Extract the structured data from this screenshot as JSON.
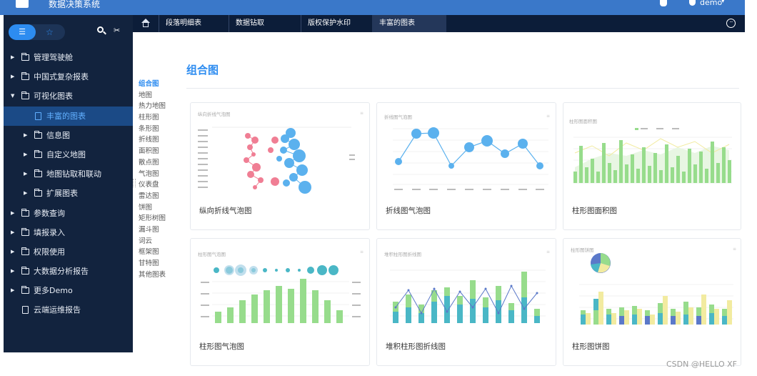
{
  "app": {
    "title": "数据决策系统",
    "user": "demo",
    "caret": "▾"
  },
  "sidebar": {
    "tab_list_icon": "☰",
    "tab_star_icon": "☆",
    "pin_icon": "✂",
    "items": [
      {
        "label": "管理驾驶舱",
        "level": 0,
        "type": "folder",
        "expanded": false
      },
      {
        "label": "中国式复杂报表",
        "level": 0,
        "type": "folder",
        "expanded": false
      },
      {
        "label": "可视化图表",
        "level": 0,
        "type": "folder",
        "expanded": true
      },
      {
        "label": "丰富的图表",
        "level": 1,
        "type": "doc",
        "active": true
      },
      {
        "label": "信息图",
        "level": 1,
        "type": "folder",
        "expanded": false
      },
      {
        "label": "自定义地图",
        "level": 1,
        "type": "folder",
        "expanded": false
      },
      {
        "label": "地图钻取和联动",
        "level": 1,
        "type": "folder",
        "expanded": false
      },
      {
        "label": "扩展图表",
        "level": 1,
        "type": "folder",
        "expanded": false
      },
      {
        "label": "参数查询",
        "level": 0,
        "type": "folder",
        "expanded": false
      },
      {
        "label": "填报录入",
        "level": 0,
        "type": "folder",
        "expanded": false
      },
      {
        "label": "权限使用",
        "level": 0,
        "type": "folder",
        "expanded": false
      },
      {
        "label": "大数据分析报告",
        "level": 0,
        "type": "folder",
        "expanded": false
      },
      {
        "label": "更多Demo",
        "level": 0,
        "type": "folder",
        "expanded": false
      },
      {
        "label": "云端运维报告",
        "level": 0,
        "type": "doc"
      }
    ]
  },
  "tabs": {
    "items": [
      "段落明细表",
      "数据钻取",
      "版权保护水印",
      "丰富的图表"
    ],
    "active_index": 3,
    "more_icon": "···"
  },
  "categories": {
    "active_index": 0,
    "items": [
      "组合图",
      "地图",
      "热力地图",
      "柱形图",
      "条形图",
      "折线图",
      "面积图",
      "散点图",
      "气泡图",
      "仪表盘",
      "雷达图",
      "饼图",
      "矩形树图",
      "漏斗图",
      "词云",
      "框架图",
      "甘特图",
      "其他图表"
    ]
  },
  "section": {
    "title": "组合图"
  },
  "cards": [
    {
      "thumb_title": "纵向折线气泡图",
      "caption": "纵向折线气泡图"
    },
    {
      "thumb_title": "折线图气泡图",
      "caption": "折线图气泡图"
    },
    {
      "thumb_title": "柱形图面积图",
      "caption": "柱形图面积图"
    },
    {
      "thumb_title": "柱形图气泡图",
      "caption": "柱形图气泡图"
    },
    {
      "thumb_title": "堆积柱形图折线图",
      "caption": "堆积柱形图折线图"
    },
    {
      "thumb_title": "柱形图饼图",
      "caption": "柱形图饼图"
    }
  ],
  "colors": {
    "topbar": "#3a78c9",
    "sidebar": "#12233e",
    "tabbar": "#0c1d39",
    "accent": "#2d8cf0",
    "green": "#97dc8c",
    "blue": "#5bb1ee",
    "pink": "#f07e94",
    "yellow": "#f2eba0",
    "teal": "#4ab7c6"
  },
  "watermark": "CSDN @HELLO XF"
}
